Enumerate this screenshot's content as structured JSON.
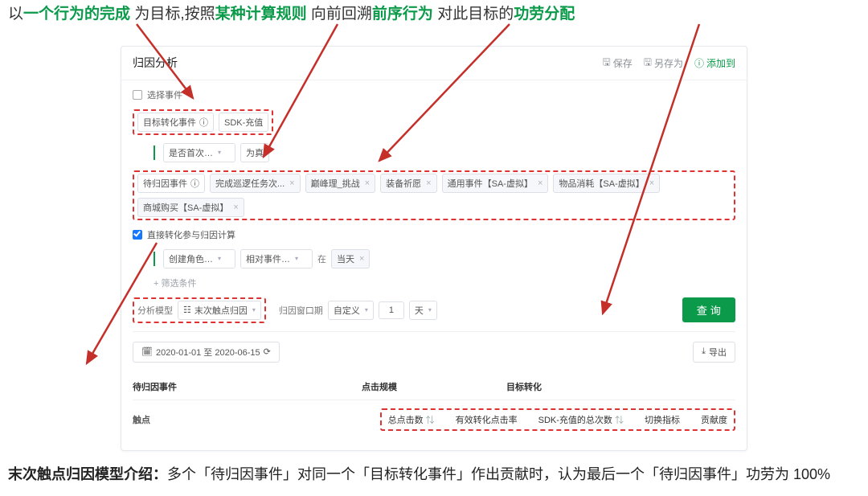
{
  "annot_top": {
    "t1": "以",
    "g1": "一个行为的完成",
    "t2": "为目标,按照",
    "g2": "某种计算规则",
    "t3": "向前回溯",
    "g3": "前序行为",
    "t4": "对此目标的",
    "g4": "功劳分配"
  },
  "header": {
    "title": "归因分析",
    "save": "保存",
    "save_as": "另存为",
    "add": "添加到"
  },
  "select_event": "选择事件",
  "target": {
    "label": "目标转化事件",
    "value": "SDK-充值"
  },
  "cond1": {
    "sel": "是否首次… ",
    "truth": "为真"
  },
  "attrib": {
    "label": "待归因事件",
    "tags": [
      "完成巡逻任务次...",
      "巅峰理_挑战",
      "装备祈愿",
      "通用事件【SA-虚拟】",
      "物品消耗【SA-虚拟】",
      "商城购买【SA-虚拟】"
    ]
  },
  "chk_direct": "直接转化参与归因计算",
  "row3": {
    "a": "创建角色…",
    "b": "相对事件…",
    "c": "在",
    "d": "当天"
  },
  "add_cond": "筛选条件",
  "model": {
    "label": "分析模型",
    "value": "末次触点归因"
  },
  "window": {
    "label": "归因窗口期",
    "custom": "自定义",
    "n": "1",
    "unit": "天"
  },
  "query": "查 询",
  "date_range": "2020-01-01 至 2020-06-15",
  "export": "导出",
  "table": {
    "th1": "待归因事件",
    "th2": "点击规模",
    "th3": "目标转化",
    "row_hit": "触点",
    "c1": "总点击数",
    "c2": "有效转化点击率",
    "c3": "SDK-充值的总次数",
    "c4": "切换指标",
    "c5": "贡献度"
  },
  "annot_bottom": {
    "lead": "末次触点归因模型介绍：",
    "rest": "多个「待归因事件」对同一个「目标转化事件」作出贡献时，认为最后一个「待归因事件」功劳为 100%"
  },
  "icons": {
    "save": "🖫",
    "info": "ⓘ",
    "plus": "+",
    "cal": "🗓",
    "refresh": "⟳",
    "export": "⤓",
    "bars": "☷",
    "swap": "⇅"
  }
}
